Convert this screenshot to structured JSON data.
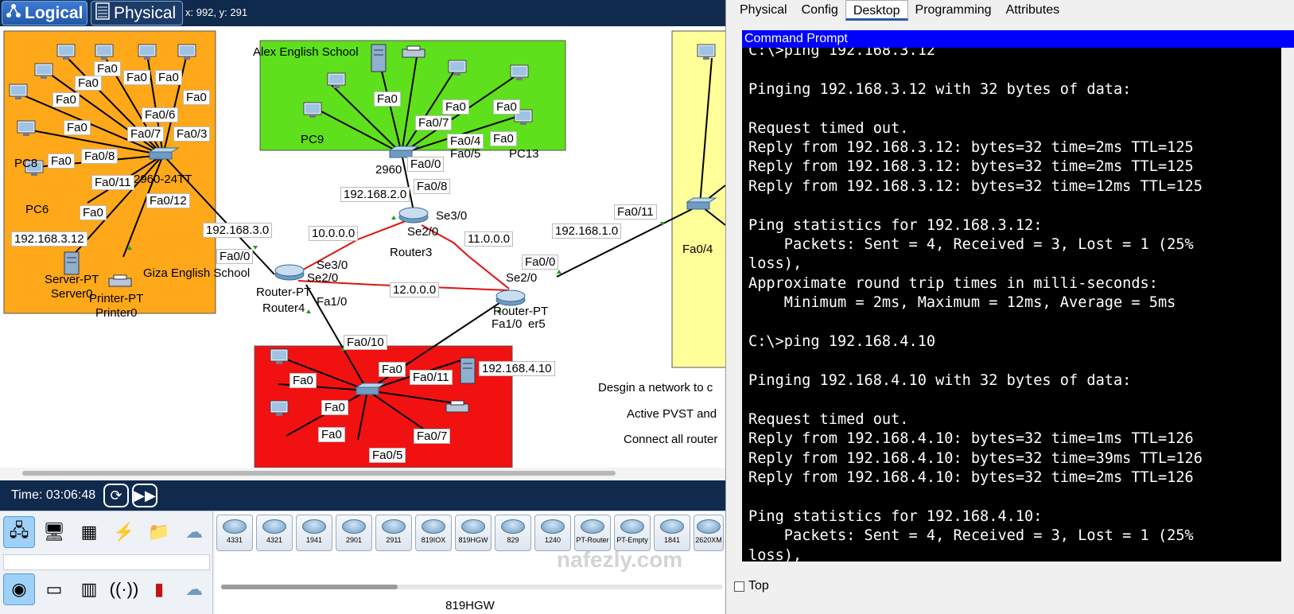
{
  "toolbar": {
    "logical_label": "Logical",
    "physical_label": "Physical",
    "coords": "x: 992, y: 291"
  },
  "areas": {
    "giza": "Giza English School",
    "alex": "Alex English School"
  },
  "network_labels": {
    "net_192_168_3_0": "192.168.3.0",
    "net_192_168_1_0": "192.168.1.0",
    "net_10": "10.0.0.0",
    "net_11": "11.0.0.0",
    "net_12": "12.0.0.0",
    "net_192_168_2_0": "192.168.2.0",
    "ip_192_168_3_12": "192.168.3.12",
    "ip_192_168_4_10": "192.168.4.10",
    "router3": "Router3",
    "router4_pt": "Router-PT",
    "router4": "Router4",
    "router5_pt": "Router-PT",
    "router5": "er5",
    "server_pt": "Server-PT",
    "server0": "Server0",
    "printer_pt": "Printer-PT",
    "printer0": "Printer0",
    "pc9": "PC9",
    "pc13": "PC13",
    "pc8": "PC8",
    "pc6": "PC6",
    "switch_alex": "2960",
    "switch_giza": "2960-24TT",
    "se3_0_r3": "Se3/0",
    "se2_0_r3": "Se2/0",
    "se3_0_r4": "Se3/0",
    "se2_0_r4": "Se2/0",
    "se2_0_r5": "Se2/0",
    "fa0_0_r4": "Fa0/0",
    "fa1_0_r4": "Fa1/0",
    "fa0_0_r5": "Fa0/0",
    "fa1_0_r5": "Fa1/0",
    "fa0_10": "Fa0/10",
    "fa0_11": "Fa0/11",
    "fa0_8": "Fa0/8",
    "fa0_0": "Fa0/0",
    "fa0_12": "Fa0/12",
    "fa0_3": "Fa0/3",
    "fa0_6": "Fa0/6",
    "fa0_7": "Fa0/7",
    "fa0_5": "Fa0/5",
    "fa0_4": "Fa0/4",
    "fa0": "Fa0",
    "note1": "Desgin a network to c",
    "note2": "Active PVST and",
    "note3": "Connect all router"
  },
  "timebar": {
    "time_label": "Time: 03:06:48"
  },
  "device_categories": [
    "network-devices",
    "end-devices",
    "components",
    "connections",
    "misc",
    "multiuser"
  ],
  "device_models": [
    "4331",
    "4321",
    "1941",
    "2901",
    "2911",
    "819IOX",
    "819HGW",
    "829",
    "1240",
    "PT-Router",
    "PT-Empty",
    "1841",
    "2620XM"
  ],
  "selected_model": "819HGW",
  "watermark": "nafezly.com",
  "dialog": {
    "tabs": [
      "Physical",
      "Config",
      "Desktop",
      "Programming",
      "Attributes"
    ],
    "active_tab": "Desktop",
    "title": "Command Prompt",
    "console_lines": [
      "C:\\>ping 192.168.3.12",
      "",
      "Pinging 192.168.3.12 with 32 bytes of data:",
      "",
      "Request timed out.",
      "Reply from 192.168.3.12: bytes=32 time=2ms TTL=125",
      "Reply from 192.168.3.12: bytes=32 time=2ms TTL=125",
      "Reply from 192.168.3.12: bytes=32 time=12ms TTL=125",
      "",
      "Ping statistics for 192.168.3.12:",
      "    Packets: Sent = 4, Received = 3, Lost = 1 (25%",
      "loss),",
      "Approximate round trip times in milli-seconds:",
      "    Minimum = 2ms, Maximum = 12ms, Average = 5ms",
      "",
      "C:\\>ping 192.168.4.10",
      "",
      "Pinging 192.168.4.10 with 32 bytes of data:",
      "",
      "Request timed out.",
      "Reply from 192.168.4.10: bytes=32 time=1ms TTL=126",
      "Reply from 192.168.4.10: bytes=32 time=39ms TTL=126",
      "Reply from 192.168.4.10: bytes=32 time=2ms TTL=126",
      "",
      "Ping statistics for 192.168.4.10:",
      "    Packets: Sent = 4, Received = 3, Lost = 1 (25%",
      "loss),"
    ],
    "top_checkbox_label": "Top"
  }
}
